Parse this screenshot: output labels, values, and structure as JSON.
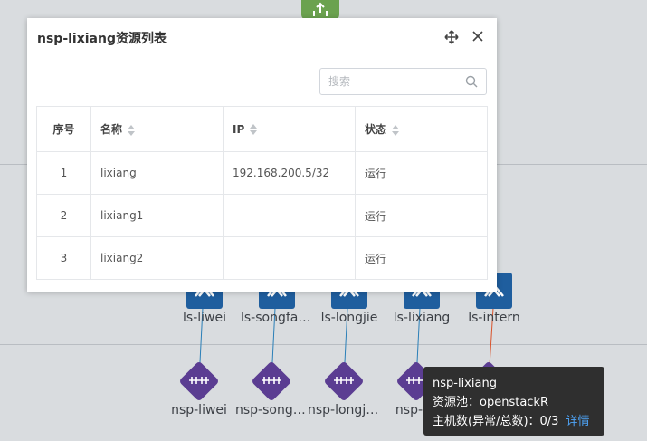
{
  "modal": {
    "title": "nsp-lixiang资源列表",
    "search_placeholder": "搜索",
    "columns": [
      "序号",
      "名称",
      "IP",
      "状态"
    ],
    "rows": [
      {
        "index": "1",
        "name": "lixiang",
        "ip": "192.168.200.5/32",
        "status": "运行"
      },
      {
        "index": "2",
        "name": "lixiang1",
        "ip": "",
        "status": "运行"
      },
      {
        "index": "3",
        "name": "lixiang2",
        "ip": "",
        "status": "运行"
      }
    ]
  },
  "switches": [
    {
      "label": "ls-liwei"
    },
    {
      "label": "ls-songfan..."
    },
    {
      "label": "ls-longjie"
    },
    {
      "label": "ls-lixiang"
    },
    {
      "label": "ls-intern"
    }
  ],
  "nsps": [
    {
      "label": "nsp-liwei"
    },
    {
      "label": "nsp-songfa..."
    },
    {
      "label": "nsp-longji..."
    },
    {
      "label": "nsp-lix"
    }
  ],
  "tooltip": {
    "name": "nsp-lixiang",
    "pool_line": "资源池：openstackR",
    "hosts_line": "主机数(异常/总数)：0/3",
    "detail_link": "详情"
  },
  "colors": {
    "switch": "#1f5e9e",
    "nsp": "#5b3d92",
    "router": "#6ba24f",
    "link_blue": "#2a7fb8",
    "link_red": "#d9532b"
  }
}
